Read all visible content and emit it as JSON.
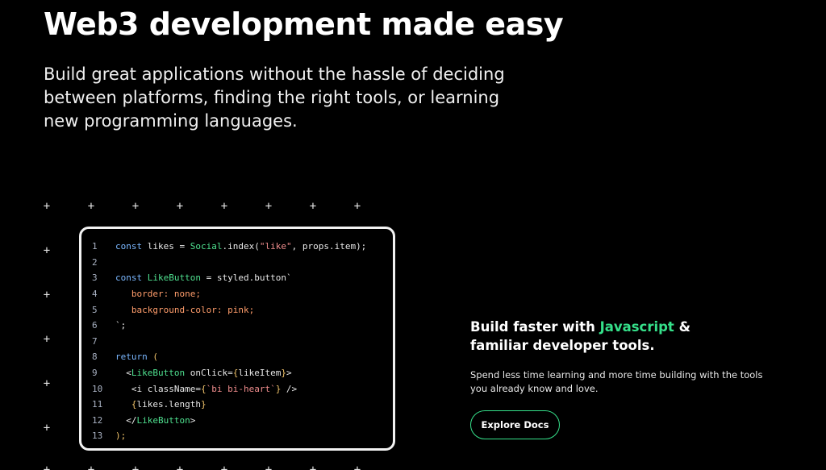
{
  "hero": {
    "title": "Web3 development made easy",
    "subtitle": "Build great applications without the hassle of deciding between platforms, finding the right tools, or learning new programming languages."
  },
  "decor": {
    "plus_glyph": "+"
  },
  "code": {
    "line_numbers": [
      "1",
      "2",
      "3",
      "4",
      "5",
      "6",
      "7",
      "8",
      "9",
      "10",
      "11",
      "12",
      "13"
    ],
    "lines": [
      [
        {
          "t": "const ",
          "c": "kw"
        },
        {
          "t": "likes = ",
          "c": "txt"
        },
        {
          "t": "Social",
          "c": "fn"
        },
        {
          "t": ".index(",
          "c": "txt"
        },
        {
          "t": "\"like\"",
          "c": "str"
        },
        {
          "t": ", props.item);",
          "c": "txt"
        }
      ],
      [],
      [
        {
          "t": "const ",
          "c": "kw"
        },
        {
          "t": "LikeButton",
          "c": "fn"
        },
        {
          "t": " = styled.button`",
          "c": "txt"
        }
      ],
      [
        {
          "t": "   border: none;",
          "c": "prop"
        }
      ],
      [
        {
          "t": "   background-color: pink;",
          "c": "prop"
        }
      ],
      [
        {
          "t": "`;",
          "c": "txt"
        }
      ],
      [],
      [
        {
          "t": "return ",
          "c": "kw"
        },
        {
          "t": "(",
          "c": "punc"
        }
      ],
      [
        {
          "t": "  <",
          "c": "txt"
        },
        {
          "t": "LikeButton",
          "c": "fn"
        },
        {
          "t": " onClick=",
          "c": "txt"
        },
        {
          "t": "{",
          "c": "punc"
        },
        {
          "t": "likeItem",
          "c": "txt"
        },
        {
          "t": "}",
          "c": "punc"
        },
        {
          "t": ">",
          "c": "txt"
        }
      ],
      [
        {
          "t": "   <i className=",
          "c": "txt"
        },
        {
          "t": "{",
          "c": "punc"
        },
        {
          "t": "`bi bi-heart`",
          "c": "str"
        },
        {
          "t": "}",
          "c": "punc"
        },
        {
          "t": " />",
          "c": "txt"
        }
      ],
      [
        {
          "t": "   ",
          "c": "txt"
        },
        {
          "t": "{",
          "c": "punc"
        },
        {
          "t": "likes.length",
          "c": "txt"
        },
        {
          "t": "}",
          "c": "punc"
        }
      ],
      [
        {
          "t": "  </",
          "c": "txt"
        },
        {
          "t": "LikeButton",
          "c": "fn"
        },
        {
          "t": ">",
          "c": "txt"
        }
      ],
      [
        {
          "t": ");",
          "c": "punc"
        }
      ]
    ]
  },
  "feature": {
    "title_prefix": "Build faster with ",
    "title_accent": "Javascript",
    "title_suffix": " & familiar developer tools.",
    "description": "Spend less time learning and more time building with the tools you already know and love.",
    "button_label": "Explore Docs",
    "accent_color": "#35e08a"
  }
}
